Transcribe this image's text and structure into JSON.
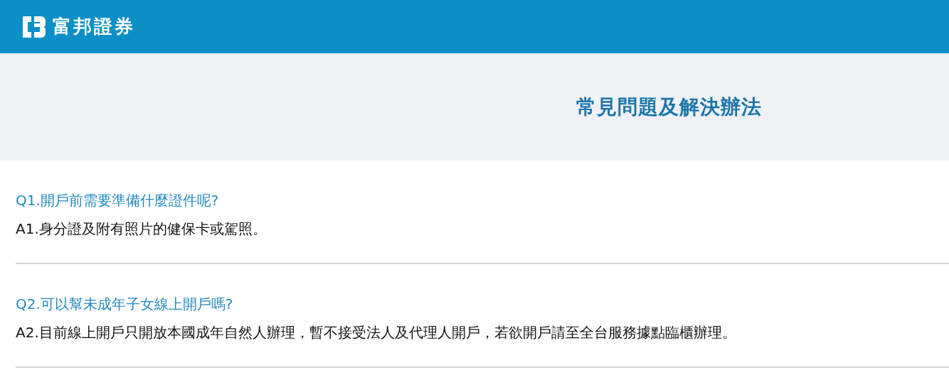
{
  "header": {
    "brand": "富邦證券"
  },
  "hero": {
    "title": "常見問題及解決辦法"
  },
  "faq": [
    {
      "question": "Q1.開戶前需要準備什麼證件呢?",
      "answer": "A1.身分證及附有照片的健保卡或駕照。"
    },
    {
      "question": "Q2.可以幫未成年子女線上開戶嗎?",
      "answer": "A2.目前線上開戶只開放本國成年自然人辦理，暫不接受法人及代理人開戶，若欲開戶請至全台服務據點臨櫃辦理。"
    }
  ]
}
